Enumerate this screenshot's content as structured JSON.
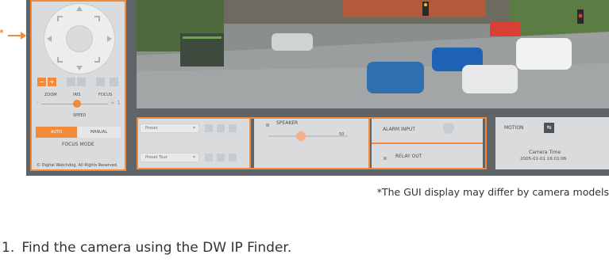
{
  "ptz": {
    "zoom_label": "ZOOM",
    "iris_label": "IRIS",
    "focus_label": "FOCUS",
    "minus": "-",
    "plus": "+ 1",
    "speed_label": "SPEED",
    "auto_label": "AUTO",
    "manual_label": "MANUAL",
    "focus_mode_label": "FOCUS MODE",
    "copyright": "© Digital Watchdog. All Rights Reserved."
  },
  "presets": {
    "preset": "Preset",
    "preset_tour": "Preset Tour"
  },
  "audio": {
    "speaker_label": "SPEAKER",
    "volume": "50"
  },
  "io": {
    "alarm_input": "ALARM INPUT",
    "relay_out": "RELAY OUT"
  },
  "status": {
    "motion": "MOTION",
    "camera_time_label": "Camera Time",
    "camera_time": "2005-01-01 16:01:06"
  },
  "marker": "*",
  "note": "*The GUI display may differ by camera models",
  "step": {
    "number": "1.",
    "text": "Find the camera using the DW IP Finder."
  },
  "colors": {
    "highlight": "#f08a3c",
    "frame": "#5f6468"
  }
}
